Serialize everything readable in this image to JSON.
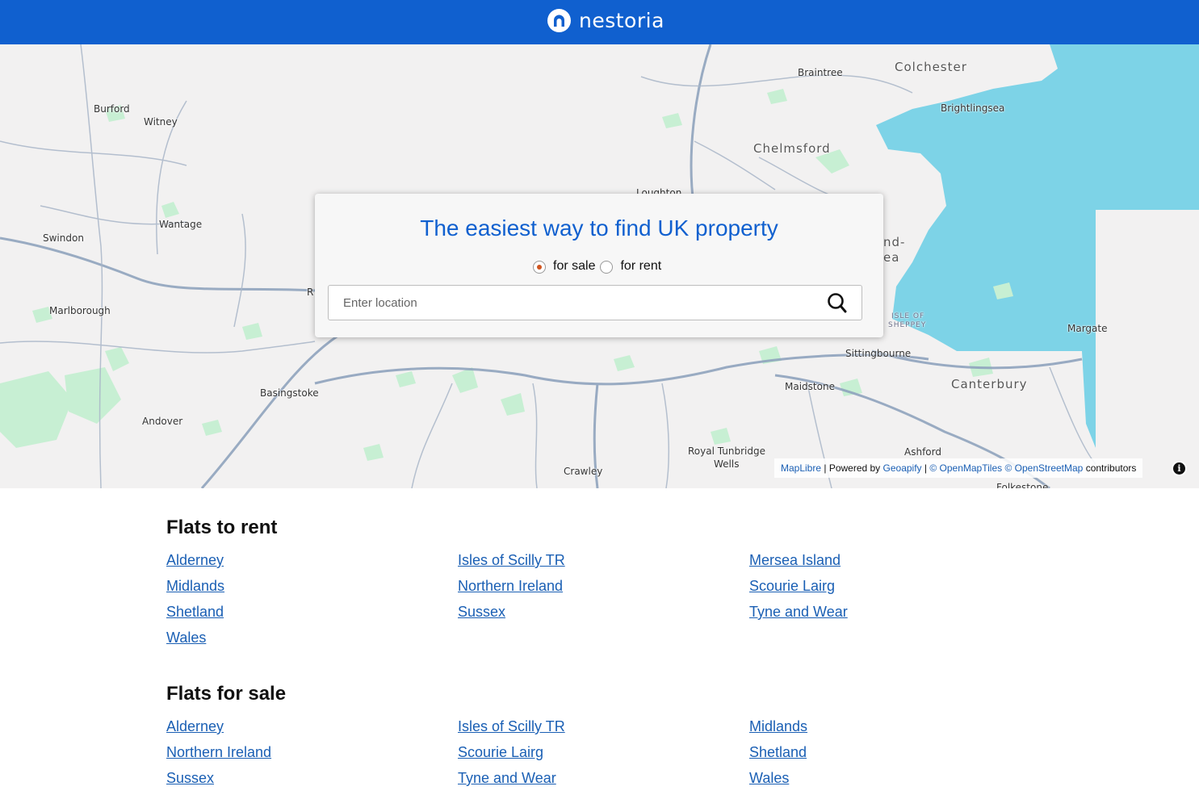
{
  "header": {
    "brand": "nestoria",
    "brand_color": "#1060cf"
  },
  "map": {
    "labels": [
      "Burford",
      "Witney",
      "Braintree",
      "Colchester",
      "Brightlingsea",
      "Chelmsford",
      "Loughton",
      "Wantage",
      "Swindon",
      "Marlborough",
      "Basingstoke",
      "Andover",
      "Crawley",
      "Royal Tunbridge",
      "Wells",
      "Maidstone",
      "Sittingbourne",
      "Canterbury",
      "Margate",
      "Ashford",
      "Folkestone",
      "ISLE OF",
      "SHEPPEY",
      "nd-",
      "ea",
      "R"
    ],
    "attribution": {
      "maplibre": "MapLibre",
      "powered_by": " | Powered by ",
      "geoapify": "Geoapify",
      "separator": " | ",
      "openmaptiles": "© OpenMapTiles",
      "openstreetmap": "© OpenStreetMap",
      "contributors": " contributors"
    },
    "info_icon": "info-icon",
    "colors": {
      "water": "#7dd3e7",
      "land": "#f2f1f1",
      "park": "#c7efd3",
      "road": "#8fa3bd"
    }
  },
  "search": {
    "headline": "The easiest way to find UK property",
    "options": [
      {
        "label": "for sale",
        "checked": true
      },
      {
        "label": "for rent",
        "checked": false
      }
    ],
    "placeholder": "Enter location",
    "icon": "search-icon"
  },
  "flats_to_rent": {
    "title": "Flats to rent",
    "links": [
      "Alderney",
      "Isles of Scilly TR",
      "Mersea Island",
      "Midlands",
      "Northern Ireland",
      "Scourie Lairg",
      "Shetland",
      "Sussex",
      "Tyne and Wear",
      "Wales"
    ]
  },
  "flats_for_sale": {
    "title": "Flats for sale",
    "links": [
      "Alderney",
      "Isles of Scilly TR",
      "Midlands",
      "Northern Ireland",
      "Scourie Lairg",
      "Shetland",
      "Sussex",
      "Tyne and Wear",
      "Wales"
    ]
  }
}
